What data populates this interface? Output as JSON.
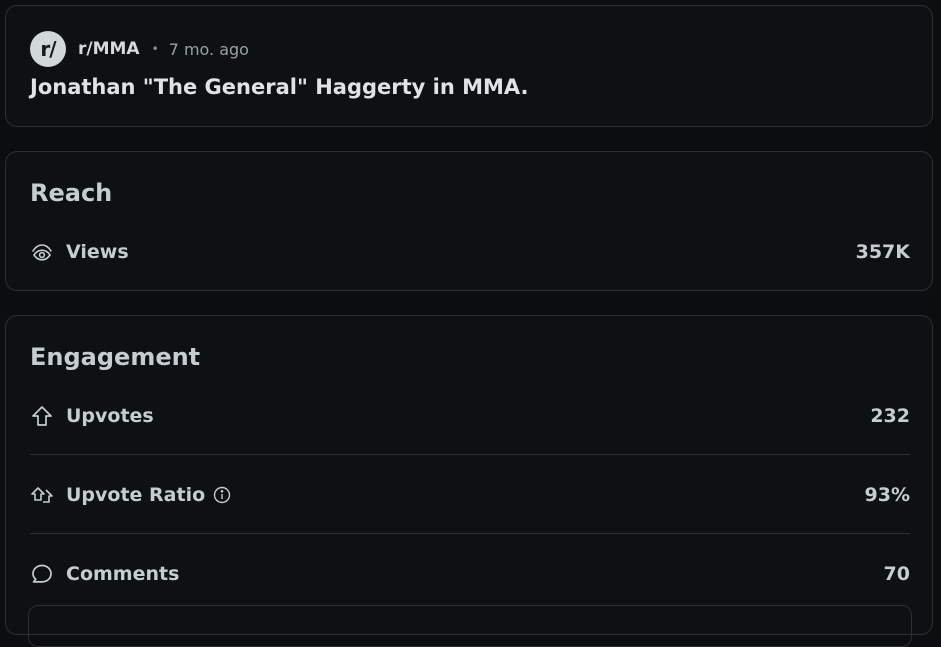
{
  "post": {
    "avatar_text": "r/",
    "subreddit": "r/MMA",
    "separator": "•",
    "age": "7 mo. ago",
    "title": "Jonathan \"The General\" Haggerty in MMA."
  },
  "reach": {
    "title": "Reach",
    "views": {
      "label": "Views",
      "value": "357K",
      "icon": "views-icon"
    }
  },
  "engagement": {
    "title": "Engagement",
    "upvotes": {
      "label": "Upvotes",
      "value": "232",
      "icon": "upvote-icon"
    },
    "upvote_ratio": {
      "label": "Upvote Ratio",
      "value": "93%",
      "icon": "upvote-ratio-icon"
    },
    "comments": {
      "label": "Comments",
      "value": "70",
      "icon": "comment-icon"
    }
  },
  "colors": {
    "background": "#0b0e11",
    "card": "#0e1113",
    "border": "#2a2f33",
    "text": "#c6ccd0"
  }
}
